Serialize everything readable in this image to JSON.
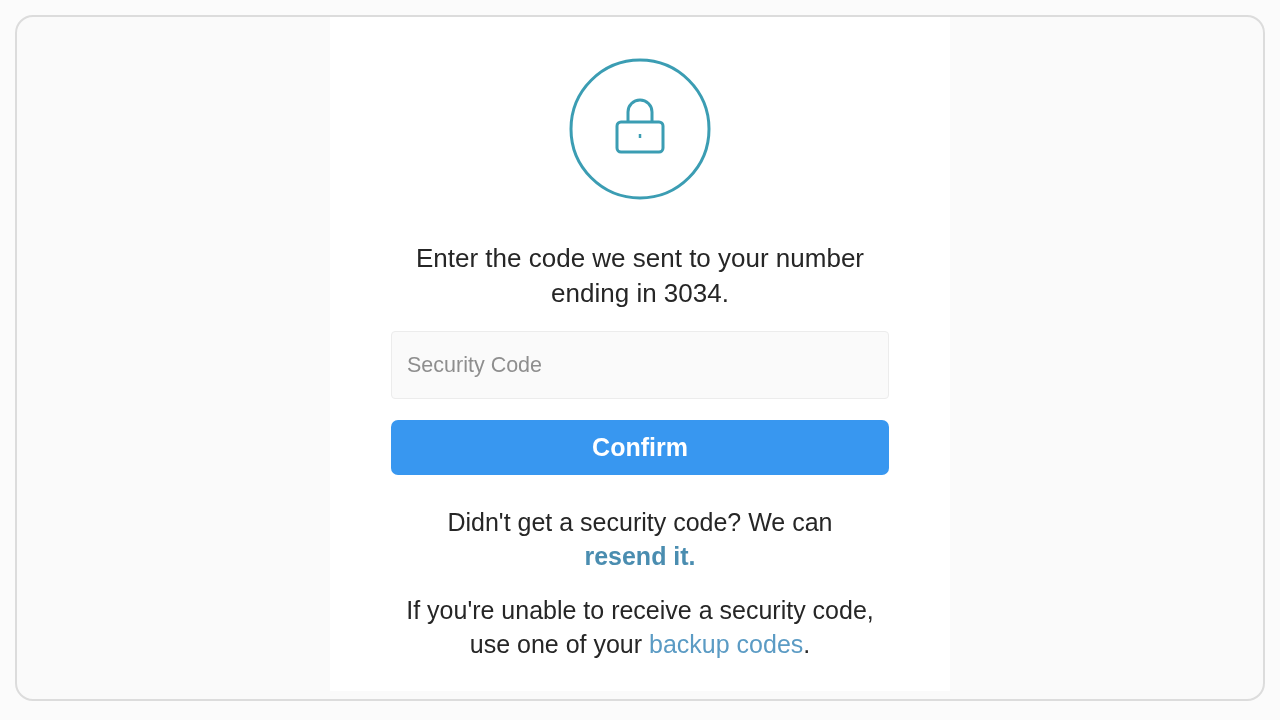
{
  "message": "Enter the code we sent to your number ending in 3034.",
  "code_field": {
    "placeholder": "Security Code"
  },
  "confirm_button": {
    "label": "Confirm"
  },
  "resend_note": {
    "text": "Didn't get a security code? We can",
    "link": "resend it."
  },
  "backup_note": {
    "text": "If you're unable to receive a security code, use one of your",
    "link": "backup codes",
    "suffix": "."
  }
}
